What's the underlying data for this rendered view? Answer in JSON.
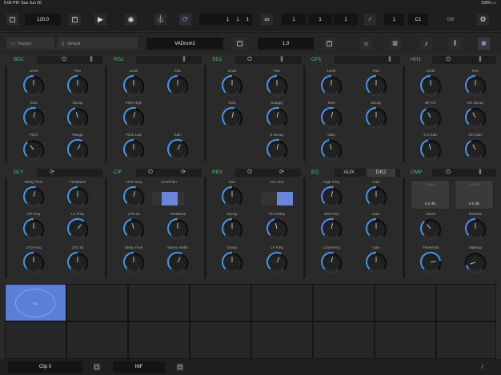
{
  "status_bar": {
    "time": "5:06 PM",
    "date": "Sun Jun 20",
    "battery": "100%"
  },
  "transport": {
    "tempo": "120.0",
    "position": [
      "1",
      "1",
      "1"
    ],
    "loop_values": [
      "1",
      "1",
      "1"
    ],
    "quantize": "1",
    "key": "C1",
    "counter": "0/8"
  },
  "preset_bar": {
    "bank": "Factory",
    "preset": "Default",
    "kit_name": "VADrum2",
    "value": "1.0"
  },
  "row1": [
    {
      "name": "BD1",
      "knobs": [
        "Level",
        "Pan",
        "Tone",
        "Decay",
        "Pitch",
        "Range"
      ]
    },
    {
      "name": "RS1",
      "knobs": [
        "Level",
        "Pan",
        "Pitch High",
        "",
        "Pitch Low",
        "Gain"
      ]
    },
    {
      "name": "SD1",
      "knobs": [
        "Level",
        "Pan",
        "Tone",
        "Snappy",
        "",
        "S-Decay"
      ]
    },
    {
      "name": "CP1",
      "knobs": [
        "Level",
        "Pan",
        "Tone",
        "Decay",
        "Gain",
        ""
      ]
    },
    {
      "name": "HH1",
      "knobs": [
        "Level",
        "Pan",
        "BP-CF",
        "OH Decay",
        "CH Gain",
        "OH Gain"
      ]
    }
  ],
  "row2": {
    "dly": {
      "name": "DLY",
      "knobs": [
        "Delay Time",
        "Feedback",
        "HP Freq",
        "LF Freq",
        "LFO Freq",
        "LFO Int"
      ]
    },
    "cf": {
      "name": "C/F",
      "knobs": [
        "LFO Freq",
        "LFO Int",
        "Feedback",
        "Delay Time",
        "Stereo Width"
      ],
      "toggle_label": "Chor/Flan"
    },
    "rev": {
      "name": "REV",
      "knobs": [
        "Size",
        "Decay",
        "Pre Delay",
        "Damp",
        "LF Freq"
      ],
      "toggle_label": "Aux Size"
    },
    "eq": {
      "name": "EQ",
      "tabs": [
        "AUX",
        "DK2"
      ],
      "knobs": [
        "High Freq",
        "Gain",
        "Mid Freq",
        "Gain",
        "LOW Freq",
        "Gain"
      ]
    },
    "cmp": {
      "name": "CMP",
      "meters": [
        "0.0 dB",
        "0.0 dB"
      ],
      "meter_marks": "-12  -6  0",
      "knobs": [
        "Attack",
        "Release",
        "Threshold",
        "Makeup"
      ]
    }
  },
  "pads": {
    "active_label": "D1"
  },
  "bottom": {
    "clip": "Clip 0",
    "length": "INF"
  },
  "colors": {
    "accent": "#48c774",
    "knob_arc": "#4a8fe0",
    "pad_active": "#5a7fd6"
  }
}
